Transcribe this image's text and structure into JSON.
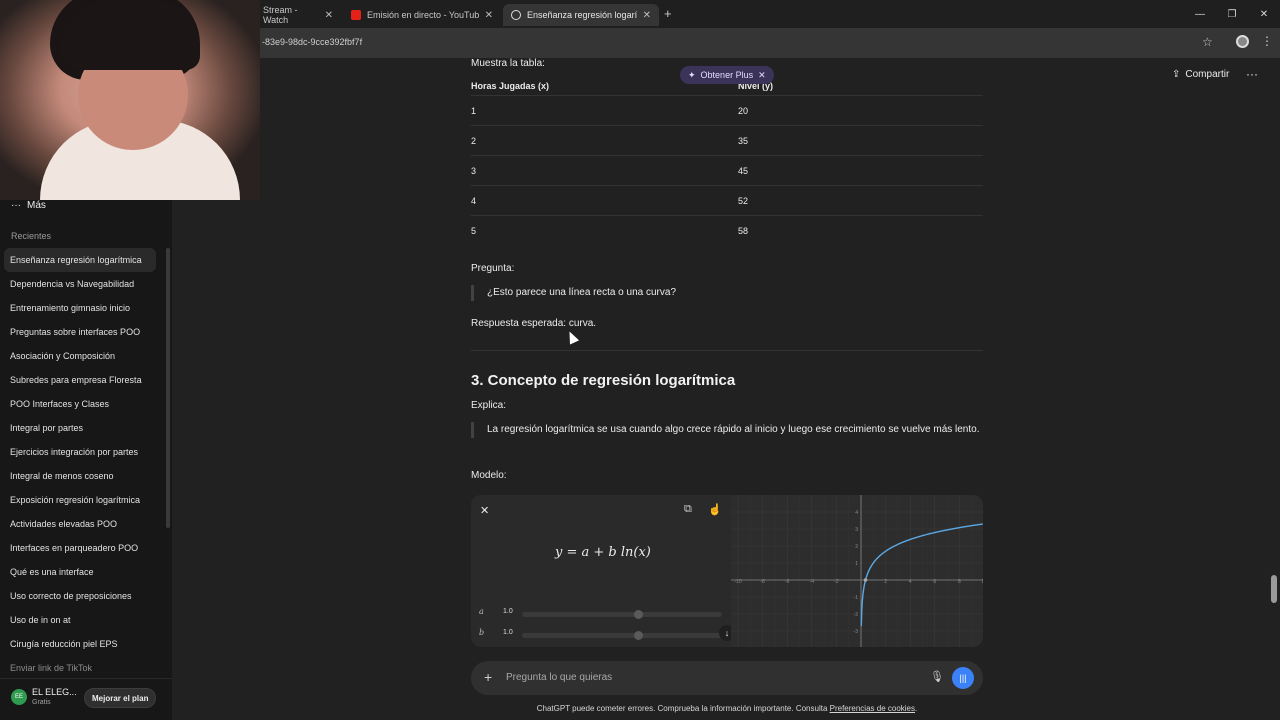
{
  "browser": {
    "tabs": [
      {
        "title": "Stream - Watch",
        "active": false
      },
      {
        "title": "Emisión en directo - YouTube S",
        "active": false
      },
      {
        "title": "Enseñanza regresión logarítmica",
        "active": true
      }
    ],
    "new_tab": "+",
    "url": "-83e9-98dc-9cce392fbf7f"
  },
  "sidebar": {
    "more_label": "Más",
    "recent_label": "Recientes",
    "items": [
      "Enseñanza regresión logarítmica",
      "Dependencia vs Navegabilidad",
      "Entrenamiento gimnasio inicio",
      "Preguntas sobre interfaces POO",
      "Asociación y Composición",
      "Subredes para empresa Floresta",
      "POO Interfaces y Clases",
      "Integral por partes",
      "Ejercicios integración por partes",
      "Integral de menos coseno",
      "Exposición regresión logarítmica",
      "Actividades elevadas POO",
      "Interfaces en parqueadero POO",
      "Qué es una interface",
      "Uso correcto de preposiciones",
      "Uso de in on at",
      "Cirugía reducción piel EPS",
      "Enviar link de TikTok"
    ],
    "user": {
      "initials": "EE",
      "name": "EL ELEG...",
      "plan": "Gratis",
      "upgrade": "Mejorar el plan"
    }
  },
  "header": {
    "share": "Compartir",
    "plus_pill": "Obtener Plus"
  },
  "content": {
    "table_intro": "Muestra la tabla:",
    "table_headers": [
      "Horas Jugadas (x)",
      "Nivel (y)"
    ],
    "table_rows": [
      [
        "1",
        "20"
      ],
      [
        "2",
        "35"
      ],
      [
        "3",
        "45"
      ],
      [
        "4",
        "52"
      ],
      [
        "5",
        "58"
      ]
    ],
    "question_label": "Pregunta:",
    "question": "¿Esto parece una línea recta o una curva?",
    "expected": "Respuesta esperada: curva.",
    "section_title": "3. Concepto de regresión logarítmica",
    "explain_label": "Explica:",
    "explanation": "La regresión logarítmica se usa cuando algo crece rápido al inicio y luego ese crecimiento se vuelve más lento.",
    "model_label": "Modelo:"
  },
  "widget": {
    "formula": "y = a + b ln(x)",
    "params": [
      {
        "symbol": "a",
        "value": "1.0"
      },
      {
        "symbol": "b",
        "value": "1.0"
      }
    ],
    "x_ticks": [
      "-10",
      "-8",
      "-6",
      "-4",
      "-2",
      "2",
      "4",
      "6",
      "8",
      "10"
    ],
    "y_ticks": [
      "4",
      "3",
      "2",
      "1",
      "-1",
      "-2",
      "-3"
    ],
    "curve_color": "#5aa9e6"
  },
  "composer": {
    "placeholder": "Pregunta lo que quieras"
  },
  "footer": {
    "text": "ChatGPT puede cometer errores. Comprueba la información importante. Consulta ",
    "link": "Preferencias de cookies",
    "end": "."
  }
}
